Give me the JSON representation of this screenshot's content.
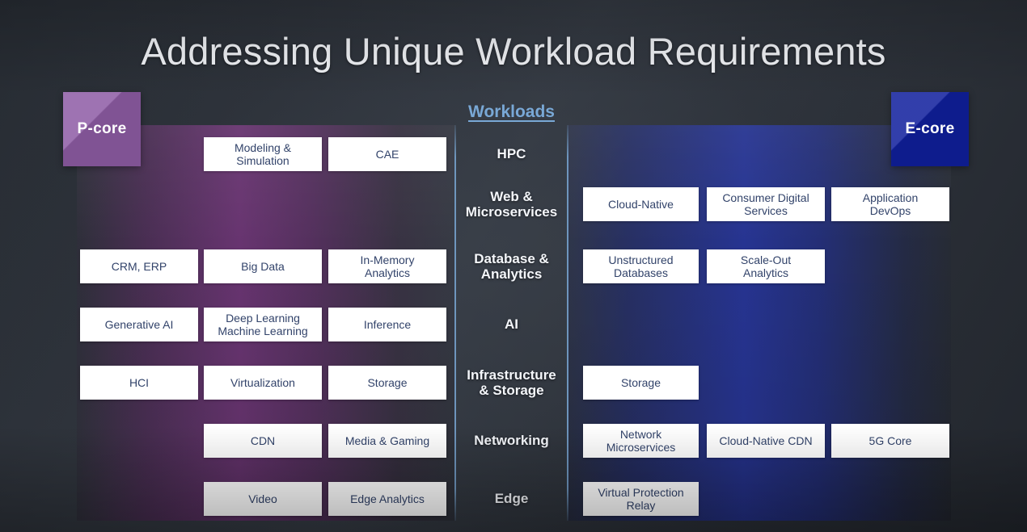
{
  "title": "Addressing Unique Workload Requirements",
  "colors": {
    "p_core": "#8e5ca5",
    "e_core": "#101f9d",
    "workloads_accent": "#79a8d6",
    "cell_text": "#32436a",
    "background": "#2b3039"
  },
  "badges": {
    "p_core": "P-core",
    "e_core": "E-core"
  },
  "center": {
    "header": "Workloads"
  },
  "rows": [
    {
      "workload": "HPC",
      "p_core": [
        "",
        "Modeling &\nSimulation",
        "CAE"
      ],
      "e_core": [
        "",
        "",
        ""
      ]
    },
    {
      "workload": "Web &\nMicroservices",
      "p_core": [
        "",
        "",
        ""
      ],
      "e_core": [
        "Cloud-Native",
        "Consumer Digital\nServices",
        "Application\nDevOps"
      ]
    },
    {
      "workload": "Database &\nAnalytics",
      "p_core": [
        "CRM, ERP",
        "Big Data",
        "In-Memory\nAnalytics"
      ],
      "e_core": [
        "Unstructured\nDatabases",
        "Scale-Out\nAnalytics",
        ""
      ]
    },
    {
      "workload": "AI",
      "p_core": [
        "Generative AI",
        "Deep Learning\nMachine Learning",
        "Inference"
      ],
      "e_core": [
        "",
        "",
        ""
      ]
    },
    {
      "workload": "Infrastructure\n& Storage",
      "p_core": [
        "HCI",
        "Virtualization",
        "Storage"
      ],
      "e_core": [
        "Storage",
        "",
        ""
      ]
    },
    {
      "workload": "Networking",
      "p_core": [
        "",
        "CDN",
        "Media & Gaming"
      ],
      "e_core": [
        "Network\nMicroservices",
        "Cloud-Native CDN",
        "5G Core"
      ]
    },
    {
      "workload": "Edge",
      "p_core": [
        "",
        "Video",
        "Edge Analytics"
      ],
      "e_core": [
        "Virtual Protection\nRelay",
        "",
        ""
      ]
    }
  ]
}
